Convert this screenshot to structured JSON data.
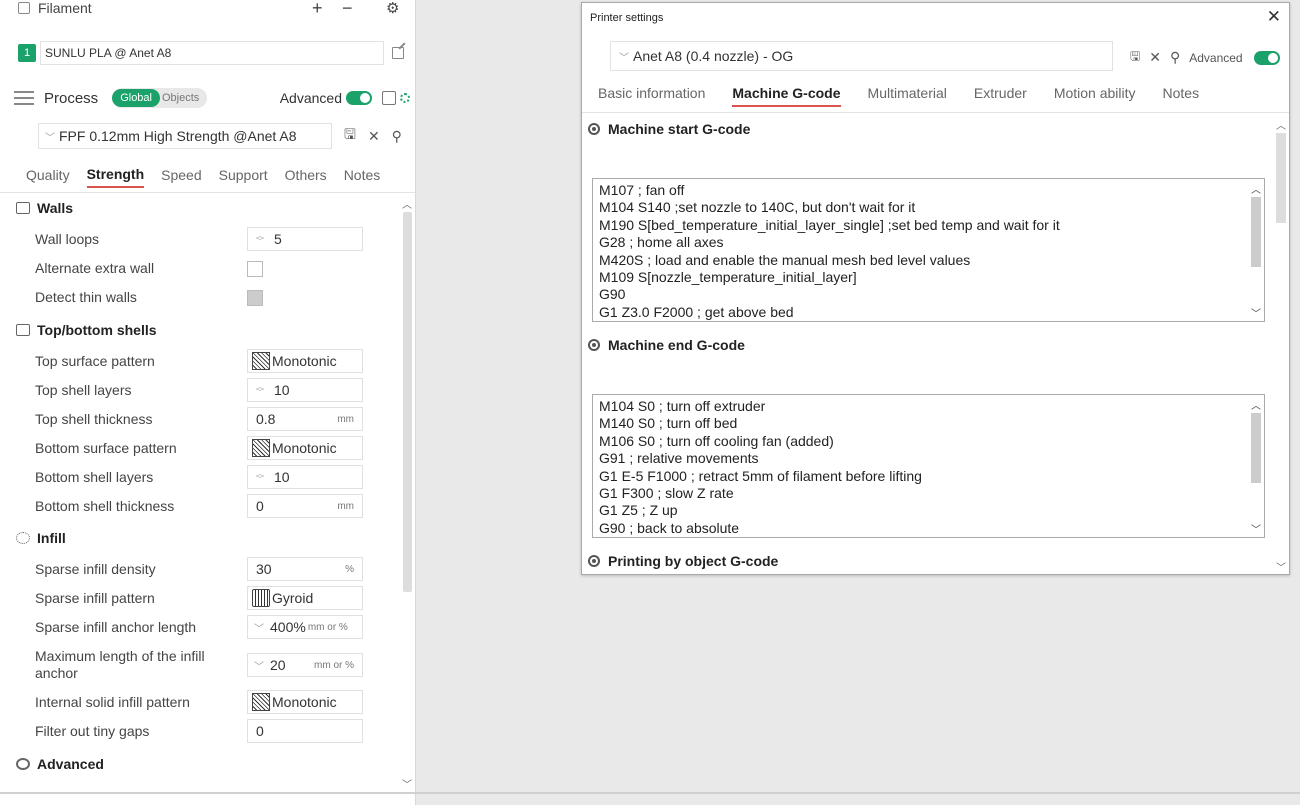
{
  "sidebar": {
    "filament_title": "Filament",
    "add_symbol": "+",
    "remove_symbol": "−",
    "filament_number": "1",
    "filament_name": "SUNLU PLA @ Anet A8",
    "process_title": "Process",
    "global_label": "Global",
    "objects_label": "Objects",
    "advanced_label": "Advanced",
    "preset_name": "FPF 0.12mm High Strength @Anet A8",
    "tabs": [
      "Quality",
      "Strength",
      "Speed",
      "Support",
      "Others",
      "Notes"
    ],
    "active_tab": "Strength",
    "sections": {
      "walls": "Walls",
      "top_bottom": "Top/bottom shells",
      "infill": "Infill",
      "advanced": "Advanced"
    },
    "options": {
      "wall_loops": {
        "label": "Wall loops",
        "value": "5"
      },
      "alternate_extra_wall": {
        "label": "Alternate extra wall"
      },
      "detect_thin_walls": {
        "label": "Detect thin walls"
      },
      "top_surface_pattern": {
        "label": "Top surface pattern",
        "value": "Monotonic"
      },
      "top_shell_layers": {
        "label": "Top shell layers",
        "value": "10"
      },
      "top_shell_thickness": {
        "label": "Top shell thickness",
        "value": "0.8",
        "unit": "mm"
      },
      "bottom_surface_pattern": {
        "label": "Bottom surface pattern",
        "value": "Monotonic"
      },
      "bottom_shell_layers": {
        "label": "Bottom shell layers",
        "value": "10"
      },
      "bottom_shell_thickness": {
        "label": "Bottom shell thickness",
        "value": "0",
        "unit": "mm"
      },
      "sparse_infill_density": {
        "label": "Sparse infill density",
        "value": "30",
        "unit": "%"
      },
      "sparse_infill_pattern": {
        "label": "Sparse infill pattern",
        "value": "Gyroid"
      },
      "sparse_infill_anchor_length": {
        "label": "Sparse infill anchor length",
        "value": "400%",
        "unit": "mm or %"
      },
      "max_infill_anchor": {
        "label": "Maximum length of the infill anchor",
        "value": "20",
        "unit": "mm or %"
      },
      "internal_solid_infill_pattern": {
        "label": "Internal solid infill pattern",
        "value": "Monotonic"
      },
      "filter_tiny_gaps": {
        "label": "Filter out tiny gaps",
        "value": "0"
      }
    }
  },
  "dialog": {
    "title": "Printer settings",
    "close_symbol": "✕",
    "preset": "Anet A8 (0.4 nozzle) - OG",
    "advanced_label": "Advanced",
    "tabs": [
      "Basic information",
      "Machine G-code",
      "Multimaterial",
      "Extruder",
      "Motion ability",
      "Notes"
    ],
    "active_tab": "Machine G-code",
    "start_section": "Machine start G-code",
    "start_code": [
      "M107 ; fan off",
      "M104 S140 ;set nozzle to 140C, but don't wait for it",
      "M190 S[bed_temperature_initial_layer_single] ;set bed temp and wait for it",
      "G28 ; home all axes",
      "M420S ; load and enable the manual mesh bed level values",
      "M109 S[nozzle_temperature_initial_layer]",
      "G90",
      "G1 Z3.0 F2000 ; get above bed"
    ],
    "end_section": "Machine end G-code",
    "end_code": [
      "M104 S0 ; turn off extruder",
      "M140 S0 ; turn off bed",
      "M106 S0 ; turn off cooling fan (added)",
      "G91 ; relative movements",
      "G1 E-5 F1000 ; retract 5mm of filament before lifting",
      "G1 F300 ; slow Z rate",
      "G1 Z5 ; Z up",
      "G90 ; back to absolute"
    ],
    "object_section": "Printing by object G-code"
  },
  "colors": {
    "accent": "#1aa26a",
    "tab_underline": "#d9534f"
  }
}
